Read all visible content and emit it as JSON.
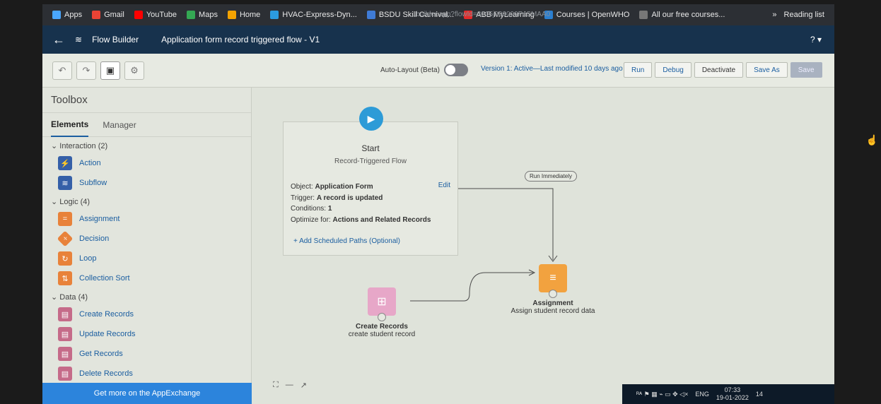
{
  "browser": {
    "url_fragment": "...builder.app?flowId=3015j000000PcSMAA0",
    "bookmarks": [
      {
        "label": "Apps",
        "icon": "apps-grid-icon",
        "color": "#4aa7ff"
      },
      {
        "label": "Gmail",
        "icon": "gmail-icon",
        "color": "#ea4335"
      },
      {
        "label": "YouTube",
        "icon": "youtube-icon",
        "color": "#ff0000"
      },
      {
        "label": "Maps",
        "icon": "maps-icon",
        "color": "#34a853"
      },
      {
        "label": "Home",
        "icon": "home-icon",
        "color": "#f4a300"
      },
      {
        "label": "HVAC-Express-Dyn...",
        "icon": "cloud-icon",
        "color": "#2b9be0"
      },
      {
        "label": "BSDU Skill Carnival...",
        "icon": "doc-icon",
        "color": "#3f7bd6"
      },
      {
        "label": "ABB MyLearning",
        "icon": "abb-icon",
        "color": "#e32b2b"
      },
      {
        "label": "Courses | OpenWHO",
        "icon": "who-icon",
        "color": "#2a7fd1"
      },
      {
        "label": "All our free courses...",
        "icon": "globe-icon",
        "color": "#777"
      }
    ],
    "more": "»",
    "reading_list": "Reading list"
  },
  "flowbar": {
    "back": "←",
    "app_name": "Flow Builder",
    "flow_title": "Application form record triggered flow - V1",
    "help": "? ▾"
  },
  "toolbar": {
    "autolayout_label": "Auto-Layout (Beta)",
    "version": "Version 1: Active—Last modified 10 days ago",
    "buttons": [
      "Run",
      "Debug",
      "Deactivate",
      "Save As",
      "Save"
    ]
  },
  "toolbox": {
    "title": "Toolbox",
    "tabs": [
      "Elements",
      "Manager"
    ],
    "sections": [
      {
        "label": "Interaction (2)",
        "items": [
          {
            "label": "Action",
            "icon": "lightning-icon",
            "color": "blue"
          },
          {
            "label": "Subflow",
            "icon": "subflow-icon",
            "color": "blue"
          }
        ]
      },
      {
        "label": "Logic (4)",
        "items": [
          {
            "label": "Assignment",
            "icon": "assignment-icon",
            "color": "orange"
          },
          {
            "label": "Decision",
            "icon": "decision-icon",
            "color": "orange"
          },
          {
            "label": "Loop",
            "icon": "loop-icon",
            "color": "orange"
          },
          {
            "label": "Collection Sort",
            "icon": "sort-icon",
            "color": "orange"
          }
        ]
      },
      {
        "label": "Data (4)",
        "items": [
          {
            "label": "Create Records",
            "icon": "create-records-icon",
            "color": "pink"
          },
          {
            "label": "Update Records",
            "icon": "update-records-icon",
            "color": "pink"
          },
          {
            "label": "Get Records",
            "icon": "get-records-icon",
            "color": "pink"
          },
          {
            "label": "Delete Records",
            "icon": "delete-records-icon",
            "color": "pink"
          }
        ]
      }
    ],
    "appexchange": "Get more on the AppExchange"
  },
  "canvas": {
    "start": {
      "title": "Start",
      "subtitle": "Record-Triggered Flow",
      "object_label": "Object:",
      "object_value": "Application Form",
      "trigger_label": "Trigger:",
      "trigger_value": "A record is updated",
      "conditions_label": "Conditions:",
      "conditions_value": "1",
      "optimize_label": "Optimize for:",
      "optimize_value": "Actions and Related Records",
      "edit": "Edit",
      "add_paths": "Add Scheduled Paths (Optional)"
    },
    "run_immediately": "Run Immediately",
    "assignment": {
      "title": "Assignment",
      "desc": "Assign student record data"
    },
    "create": {
      "title": "Create Records",
      "desc": "create student record"
    }
  },
  "taskbar": {
    "lang": "ENG",
    "time": "07:33",
    "date": "19-01-2022",
    "notifications": "14"
  }
}
